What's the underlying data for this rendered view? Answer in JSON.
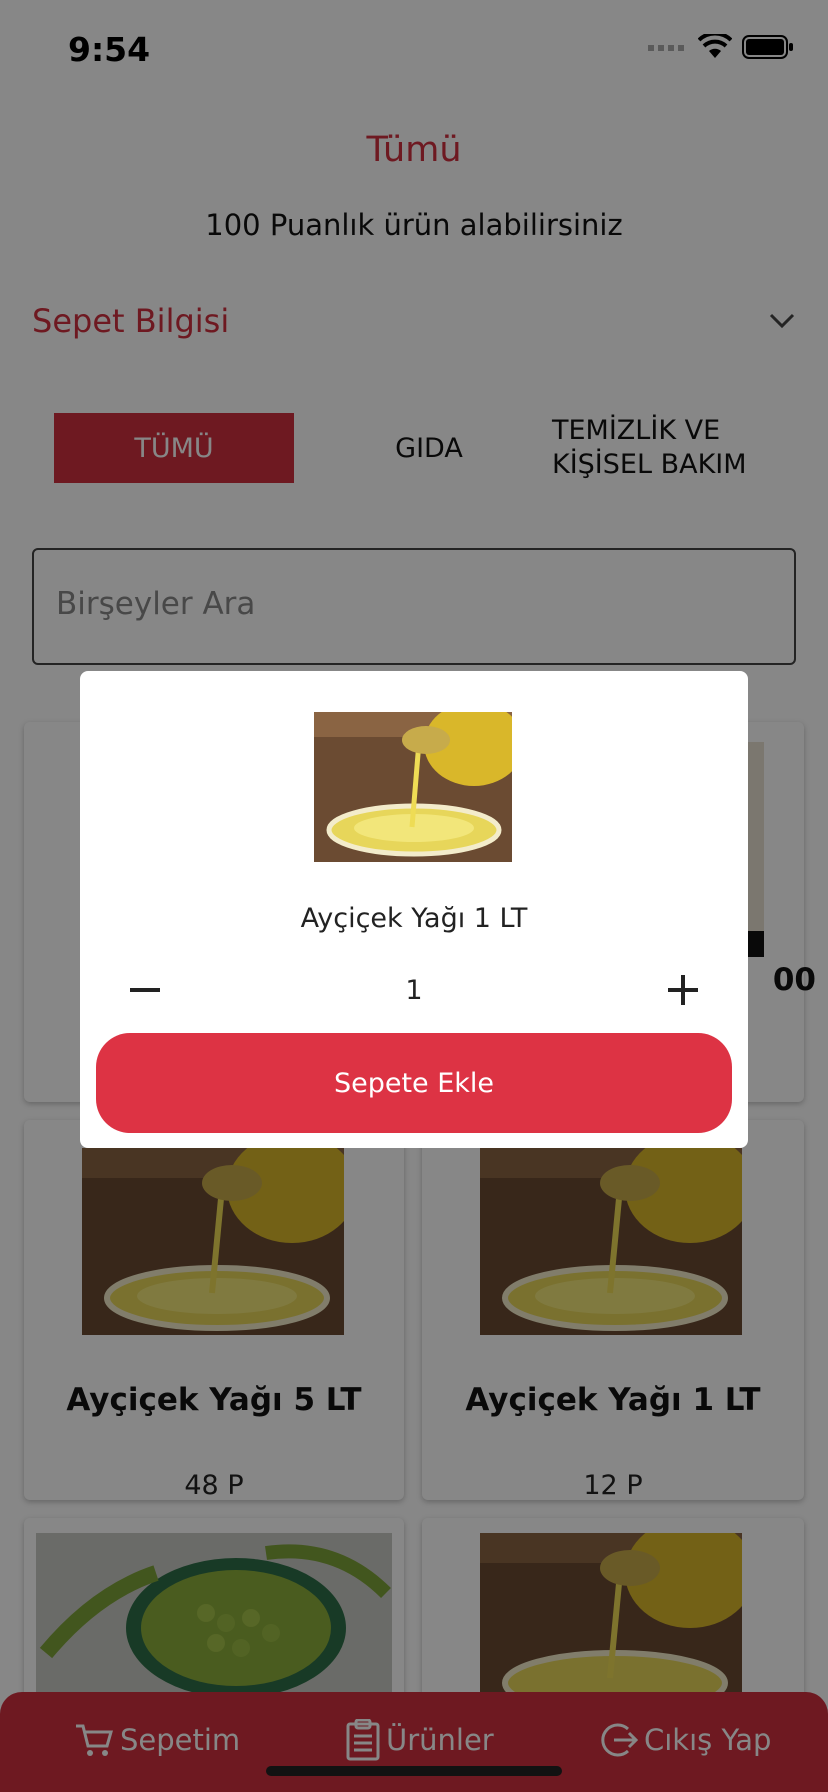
{
  "status_bar": {
    "time": "9:54"
  },
  "header": {
    "title": "Tümü",
    "points_text": "100 Puanlık ürün alabilirsiniz"
  },
  "cart_info": {
    "label": "Sepet Bilgisi"
  },
  "tabs": [
    {
      "label": "TÜMÜ",
      "active": true
    },
    {
      "label": "GIDA",
      "active": false
    },
    {
      "label": "TEMİZLİK VE KİŞİSEL BAKIM",
      "active": false
    }
  ],
  "search": {
    "placeholder": "Birşeyler Ara"
  },
  "products": [
    {
      "name": "Ayçiçek Yağı 5 LT",
      "price": "48 P",
      "image": "oil-image"
    },
    {
      "name": "Ayçiçek Yağı 1 LT",
      "price": "12 P",
      "image": "oil-image"
    },
    {
      "name": "",
      "price": "",
      "image": "peas-image"
    },
    {
      "name": "",
      "price": "",
      "image": "oil-image"
    }
  ],
  "partial_price": "00",
  "dialog": {
    "product_name": "Ayçiçek Yağı 1 LT",
    "quantity": "1",
    "add_button": "Sepete Ekle"
  },
  "bottom_nav": {
    "cart": "Sepetim",
    "products": "Ürünler",
    "logout": "Cıkış Yap"
  },
  "colors": {
    "accent": "#d0303f",
    "button": "#dd3344",
    "overlay": "rgba(0,0,0,0.47)"
  }
}
